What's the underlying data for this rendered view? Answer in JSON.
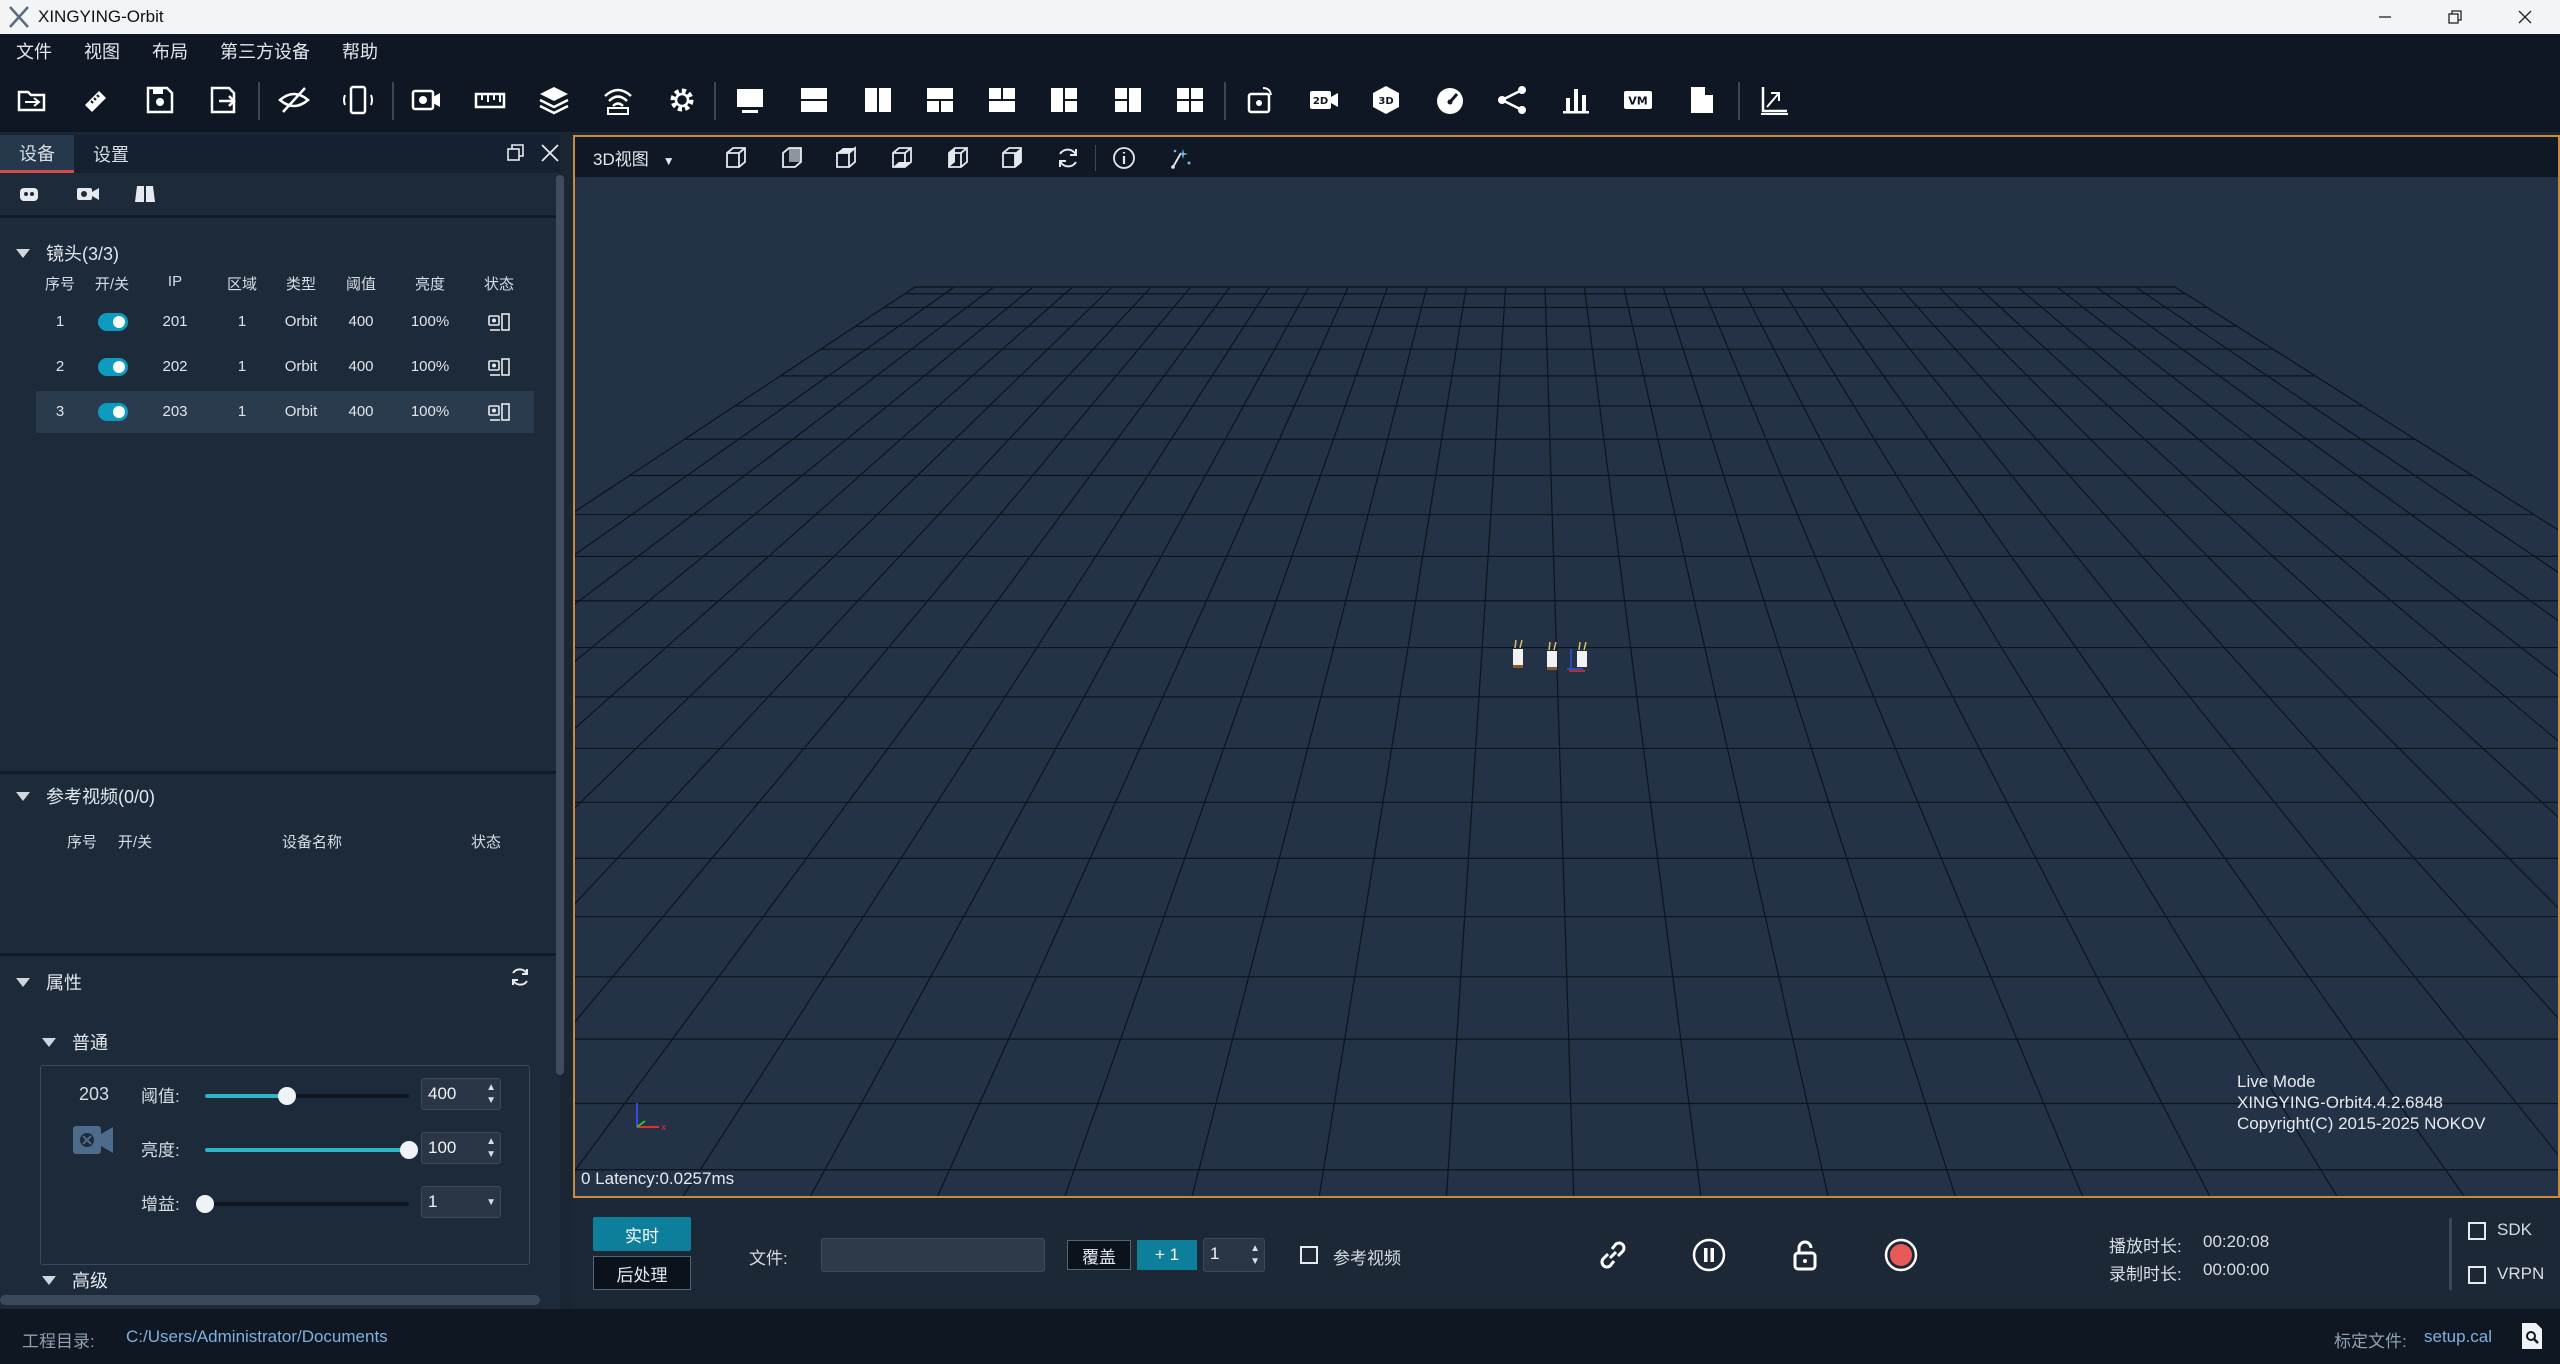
{
  "window": {
    "title": "XINGYING-Orbit"
  },
  "menu": [
    "文件",
    "视图",
    "布局",
    "第三方设备",
    "帮助"
  ],
  "toolbar_icons": [
    "open-folder",
    "measure-ruler",
    "save-disk",
    "save-as",
    "hide-eye",
    "phone-sync",
    "camera",
    "ruler-strip",
    "layers",
    "wireless",
    "gear",
    "layout-single",
    "layout-two-h",
    "layout-two-v",
    "layout-three-a",
    "layout-three-b",
    "layout-three-c",
    "layout-three-d",
    "layout-four",
    "rotate-view",
    "2d-camera",
    "3d-view",
    "gauge",
    "graph-nodes",
    "bar-chart",
    "vm",
    "document",
    "axis-calibrate"
  ],
  "left_panel": {
    "tabs": [
      "设备",
      "设置"
    ],
    "cameras": {
      "header": "镜头(3/3)",
      "columns": [
        "序号",
        "开/关",
        "IP",
        "区域",
        "类型",
        "阈值",
        "亮度",
        "状态"
      ],
      "rows": [
        {
          "no": "1",
          "ip": "201",
          "region": "1",
          "type": "Orbit",
          "threshold": "400",
          "brightness": "100%"
        },
        {
          "no": "2",
          "ip": "202",
          "region": "1",
          "type": "Orbit",
          "threshold": "400",
          "brightness": "100%"
        },
        {
          "no": "3",
          "ip": "203",
          "region": "1",
          "type": "Orbit",
          "threshold": "400",
          "brightness": "100%"
        }
      ]
    },
    "ref_video": {
      "header": "参考视频(0/0)",
      "columns": [
        "序号",
        "开/关",
        "设备名称",
        "状态"
      ]
    },
    "properties": {
      "header": "属性",
      "general": "普通",
      "camera_id": "203",
      "threshold_label": "阈值:",
      "threshold_value": "400",
      "threshold_fraction": 0.4,
      "brightness_label": "亮度:",
      "brightness_value": "100",
      "brightness_fraction": 1.0,
      "gain_label": "增益:",
      "gain_value": "1",
      "gain_fraction": 0.0,
      "advanced": "高级"
    }
  },
  "viewport": {
    "view_mode": "3D视图",
    "latency": "0 Latency:0.0257ms",
    "mode_line1": "Live Mode",
    "mode_line2": "XINGYING-Orbit4.4.2.6848",
    "mode_line3": "Copyright(C) 2015-2025 NOKOV"
  },
  "controls": {
    "realtime": "实时",
    "postprocess": "后处理",
    "file_label": "文件:",
    "file_value": "",
    "overwrite": "覆盖",
    "plus_one": "+ 1",
    "counter": "1",
    "ref_video_label": "参考视频",
    "play_duration_label": "播放时长:",
    "play_duration": "00:20:08",
    "record_duration_label": "录制时长:",
    "record_duration": "00:00:00",
    "sdk": "SDK",
    "vrpn": "VRPN"
  },
  "status": {
    "project_label": "工程目录:",
    "project_path": "C:/Users/Administrator/Documents",
    "cal_label": "标定文件:",
    "cal_file": "setup.cal"
  },
  "colors": {
    "accent": "#0e7f9a",
    "record": "#e85a5a",
    "viewport_border": "#cc8a3b"
  }
}
